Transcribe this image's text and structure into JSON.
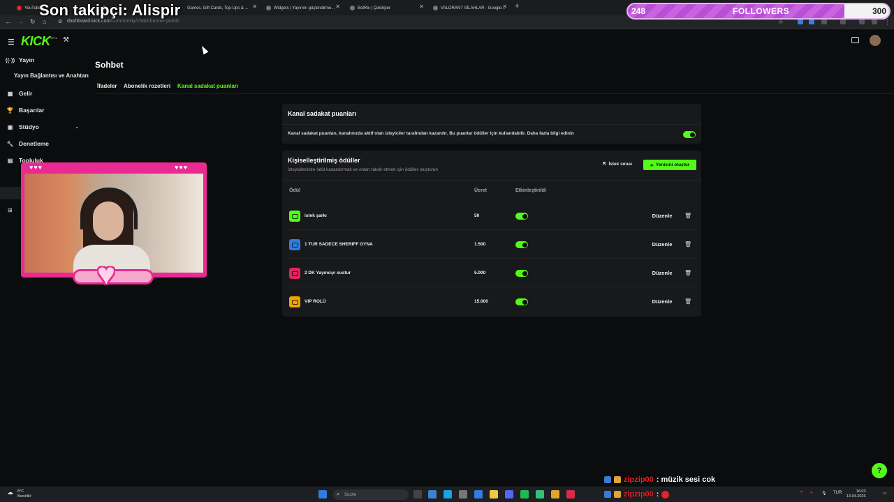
{
  "browser": {
    "tabs": [
      {
        "label": "YouTube"
      },
      {
        "label": ""
      },
      {
        "label": "Games, Gift Cards, Top-Ups & ..."
      },
      {
        "label": "Widgets | Yayınını güçlendirme..."
      },
      {
        "label": "BotRix | Çekilişler"
      },
      {
        "label": "VALORANT SİLAHLAR - Google..."
      }
    ],
    "new_tab": "+",
    "url_host": "dashboard.kick.com",
    "url_path": "/community/chat/channel-points"
  },
  "overlay": {
    "last_follower": "Son takipçi: Alispir",
    "followers": {
      "label": "FOLLOWERS",
      "current": "248",
      "goal": "300",
      "progress": 0.83
    }
  },
  "sidebar": {
    "logo": "KICK",
    "logo_sup": "BETA",
    "items": [
      {
        "label": "Yayın",
        "icon": "broadcast-icon"
      },
      {
        "label": "Yayın Bağlantısı ve Anahtarı"
      },
      {
        "label": "Gelir",
        "icon": "revenue-icon"
      },
      {
        "label": "Başarılar",
        "icon": "trophy-icon"
      },
      {
        "label": "Stüdyo",
        "icon": "studio-icon"
      },
      {
        "label": "Denetleme",
        "icon": "wrench-icon"
      },
      {
        "label": "Topluluk",
        "icon": "community-icon"
      }
    ]
  },
  "page": {
    "title": "Sohbet",
    "tabs": [
      {
        "label": "İfadeler"
      },
      {
        "label": "Abonelik rozetleri"
      },
      {
        "label": "Kanal sadakat puanları",
        "active": true
      }
    ]
  },
  "loyalty": {
    "title": "Kanal sadakat puanları",
    "description": "Kanal sadakat puanları, kanalınızda aktif olan izleyiciler tarafından kazanılır. Bu puanlar ödüller için kullanılabilir. Daha fazla bilgi edinin",
    "enabled": true
  },
  "rewards": {
    "title": "Kişiselleştirilmiş ödüller",
    "subtitle": "İzleyicilerinize ödül kazandırmak ve onları takdir etmek için ödüller oluşturun",
    "queue_label": "İstek sırası",
    "create_label": "Yenisini oluştur",
    "columns": {
      "reward": "Ödül",
      "cost": "Ücret",
      "enabled": "Etkinleştirildi"
    },
    "edit_label": "Düzenle",
    "rows": [
      {
        "name": "istek şarkı",
        "cost": "50",
        "color": "#53fc18",
        "enabled": true
      },
      {
        "name": "1 TUR SADECE SHERIFF OYNA",
        "cost": "1.500",
        "color": "#2f7de1",
        "enabled": true
      },
      {
        "name": "2 DK Yayıncıyı sustur",
        "cost": "5.000",
        "color": "#e0245e",
        "enabled": true
      },
      {
        "name": "VIP ROLÜ",
        "cost": "15.000",
        "color": "#f0a500",
        "enabled": true
      }
    ]
  },
  "chat": [
    {
      "user": "zipzip00",
      "message": ": müzik sesi cok"
    },
    {
      "user": "zipzip00",
      "message": ":"
    }
  ],
  "taskbar": {
    "weather_temp": "8°C",
    "weather_desc": "Bewölkt",
    "search_placeholder": "Suche",
    "lang": "TUR",
    "time": "16:03",
    "date": "13.04.2026"
  },
  "colors": {
    "accent": "#53fc18",
    "overlay_pink": "#e92a93",
    "follow_purple": "#b94fd6"
  }
}
